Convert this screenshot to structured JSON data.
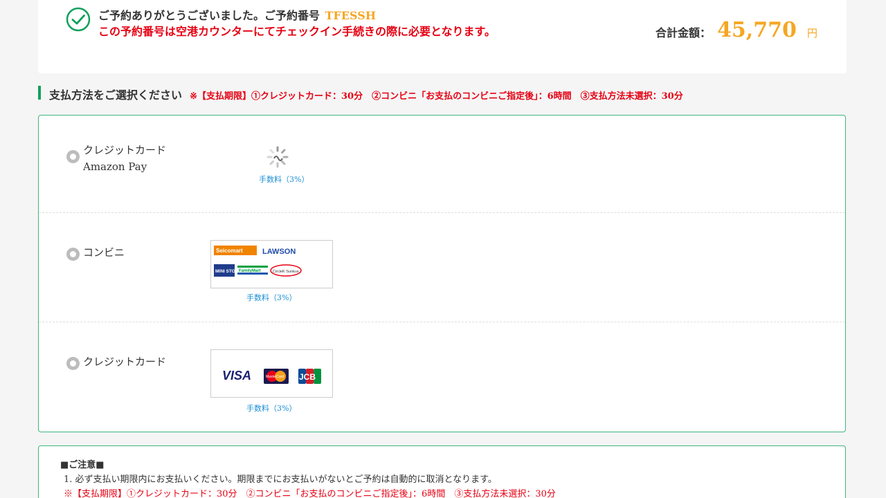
{
  "confirmation": {
    "message": "ご予約ありがとうございました。ご予約番号",
    "reservation_number": "TFESSH",
    "notice": "この予約番号は空港カウンターにてチェックイン手続きの際に必要となります。",
    "total_label": "合計金額：",
    "total_amount": "45,770",
    "total_unit": "円"
  },
  "payment_section": {
    "title": "支払方法をご選択ください",
    "deadline_note": "※【支払期限】①クレジットカード：30分　②コンビニ「お支払のコンビニご指定後」：6時間　③支払方法未選択：30分",
    "options": [
      {
        "label_line1": "クレジットカード",
        "label_line2": "Amazon Pay",
        "fee": "手数料（3%）",
        "logo": "amazon-pay-loading"
      },
      {
        "label_line1": "コンビニ",
        "fee": "手数料（3%）",
        "logos": [
          "Seicomart",
          "LAWSON",
          "MINI STOP",
          "FamilyMart",
          "CircleK Sunkus"
        ]
      },
      {
        "label_line1": "クレジットカード",
        "fee": "手数料（3%）",
        "logos": [
          "VISA",
          "MasterCard",
          "JCB"
        ]
      }
    ]
  },
  "caution": {
    "heading": "■ご注意■",
    "line1": "1. 必ず支払い期限内にお支払いください。期限までにお支払いがないとご予約は自動的に取消となります。",
    "line2": "※【支払期限】①クレジットカード：30分　②コンビニ「お支払のコンビニご指定後」：6時間　③支払方法未選択：30分"
  },
  "colors": {
    "accent_green": "#12a05c",
    "warning_red": "#e60012",
    "amount_orange": "#f5a623",
    "fee_blue": "#1c8fd6"
  }
}
